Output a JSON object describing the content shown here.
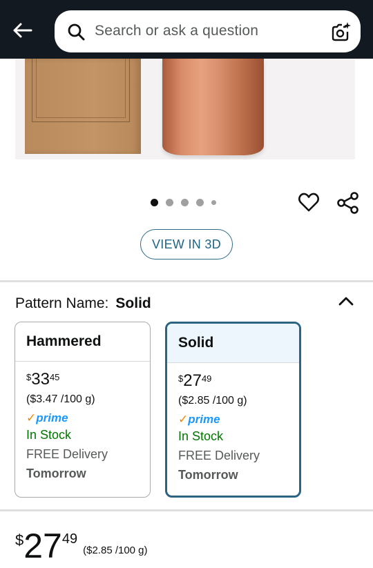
{
  "header": {
    "search_placeholder": "Search or ask a question",
    "back_icon": "arrow-left-icon",
    "camera_icon": "camera-sparkle-icon"
  },
  "gallery": {
    "dot_count": 5,
    "active_dot": 1
  },
  "actions": {
    "view_3d_label": "VIEW IN 3D"
  },
  "pattern": {
    "label": "Pattern Name:",
    "value": "Solid"
  },
  "options": [
    {
      "name": "Hammered",
      "price_symbol": "$",
      "price_whole": "33",
      "price_fraction": "45",
      "unit_price": "($3.47 /100 g)",
      "prime_check": "✓",
      "prime_label": "prime",
      "stock": "In Stock",
      "delivery": "FREE Delivery",
      "delivery_day": "Tomorrow",
      "selected": false
    },
    {
      "name": "Solid",
      "price_symbol": "$",
      "price_whole": "27",
      "price_fraction": "49",
      "unit_price": "($2.85 /100 g)",
      "prime_check": "✓",
      "prime_label": "prime",
      "stock": "In Stock",
      "delivery": "FREE Delivery",
      "delivery_day": "Tomorrow",
      "selected": true
    }
  ],
  "price": {
    "symbol": "$",
    "whole": "27",
    "fraction": "49",
    "per_unit": "($2.85 /100 g)"
  },
  "colors": {
    "header_bg": "#131921",
    "accent_blue": "#2b6383",
    "prime_blue": "#1a98ff",
    "prime_check": "#f08804",
    "in_stock": "#007600"
  }
}
